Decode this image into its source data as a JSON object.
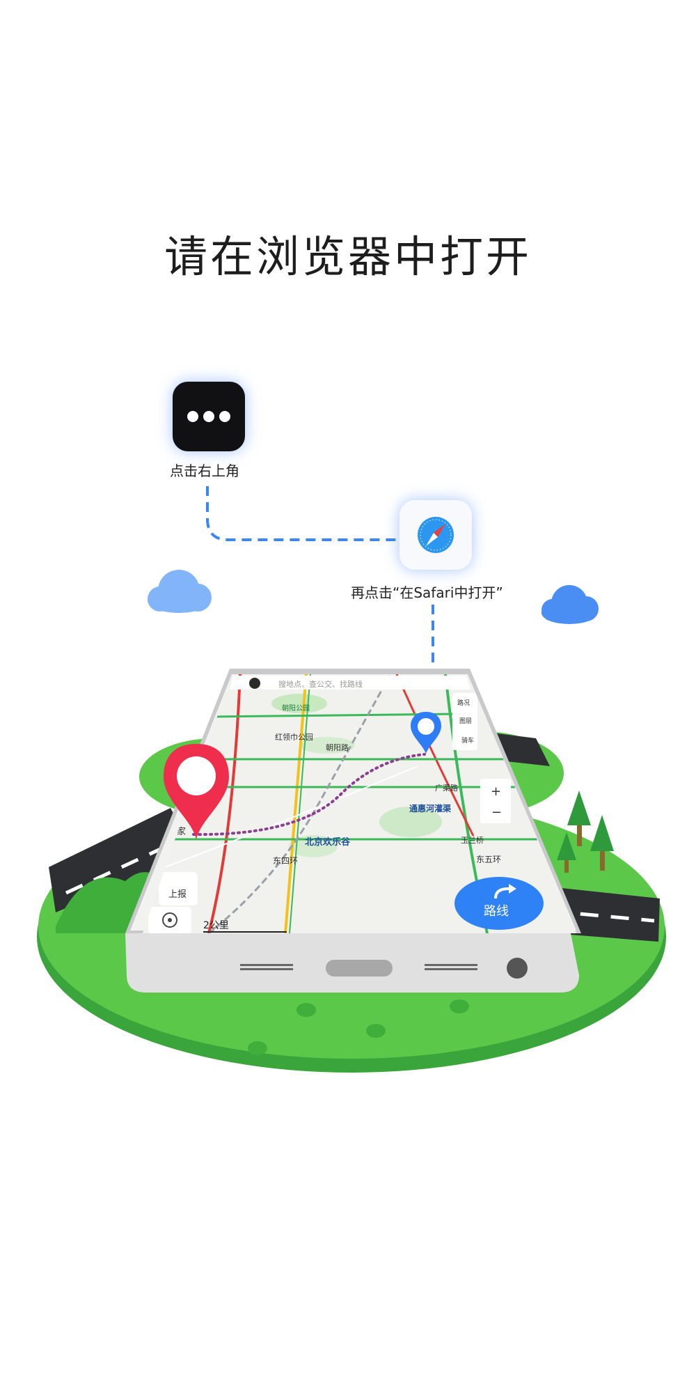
{
  "title": "请在浏览器中打开",
  "steps": [
    {
      "icon": "more-icon",
      "label": "点击右上角"
    },
    {
      "icon": "safari-compass-icon",
      "label": "再点击“在Safari中打开”"
    }
  ],
  "phone_map": {
    "search_placeholder": "搜地点、查公交、找路线",
    "place_labels": [
      "朝阳公园",
      "红领巾公园",
      "朝阳路",
      "通惠河灌渠",
      "北京欢乐谷",
      "东四环",
      "东五环",
      "广渠路",
      "玉兰桥",
      "家"
    ],
    "side_buttons": [
      "路况",
      "图层",
      "骑车"
    ],
    "zoom_in": "+",
    "zoom_out": "−",
    "report_label": "上报",
    "scale_label": "2公里",
    "route_button": "路线"
  },
  "colors": {
    "grass": "#5cc84a",
    "grass_dark": "#3aa53a",
    "road": "#2d2f33",
    "pin_red": "#ef2d4c",
    "pin_blue": "#2e7cf6",
    "cloud_blue": "#72a9f8",
    "route_dots_start": "#e23a4b",
    "route_dots_end": "#3c73e6",
    "dash_line": "#3b86f6"
  }
}
